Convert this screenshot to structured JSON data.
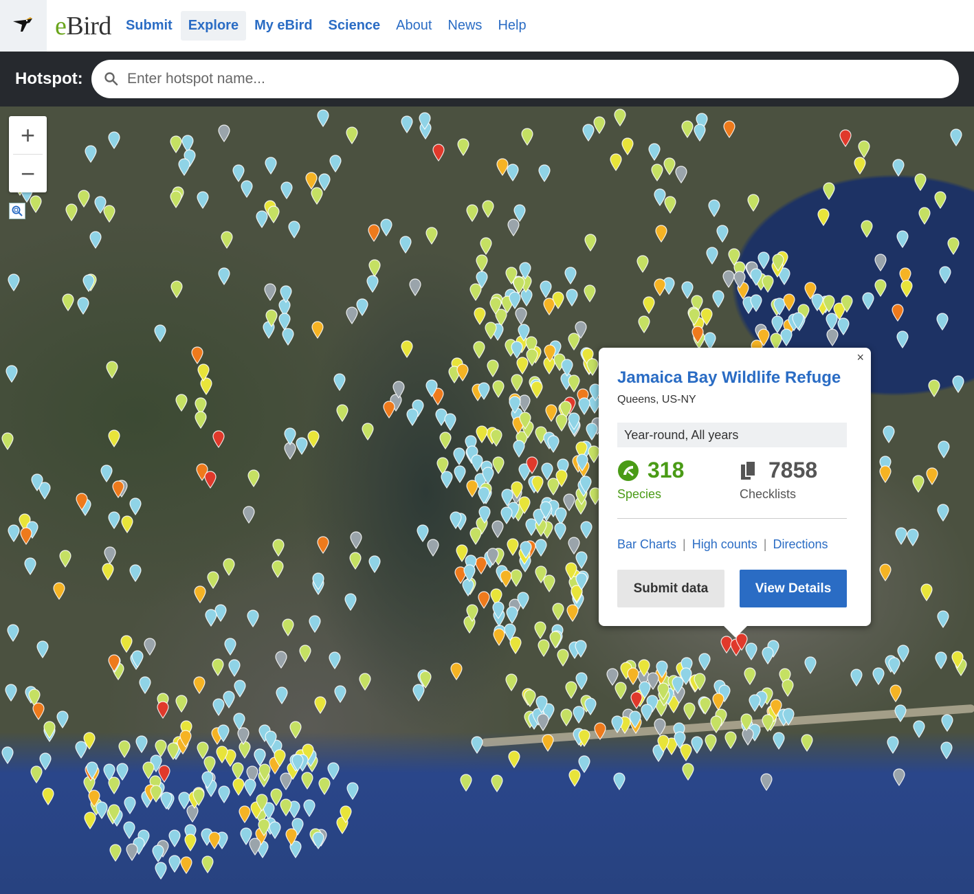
{
  "nav": {
    "brand_e": "e",
    "brand_rest": "Bird",
    "items": [
      {
        "label": "Submit",
        "bold": true
      },
      {
        "label": "Explore",
        "bold": true
      },
      {
        "label": "My eBird",
        "bold": true
      },
      {
        "label": "Science",
        "bold": true
      },
      {
        "label": "About",
        "bold": false
      },
      {
        "label": "News",
        "bold": false
      },
      {
        "label": "Help",
        "bold": false
      }
    ]
  },
  "hotspot_bar": {
    "label": "Hotspot:",
    "placeholder": "Enter hotspot name..."
  },
  "map": {
    "zoom_in": "+",
    "zoom_out": "−",
    "pin_colors": [
      "#8fd3e6",
      "#c5e063",
      "#e8e43a",
      "#f5b324",
      "#ee7a1c",
      "#e0392b",
      "#9aa4ab"
    ]
  },
  "popup": {
    "title": "Jamaica Bay Wildlife Refuge",
    "location": "Queens, US-NY",
    "range": "Year-round, All years",
    "species_count": "318",
    "species_label": "Species",
    "checklist_count": "7858",
    "checklist_label": "Checklists",
    "links": [
      "Bar Charts",
      "High counts",
      "Directions"
    ],
    "submit_label": "Submit data",
    "view_label": "View Details",
    "close": "×",
    "species_color": "#4a9b16"
  }
}
